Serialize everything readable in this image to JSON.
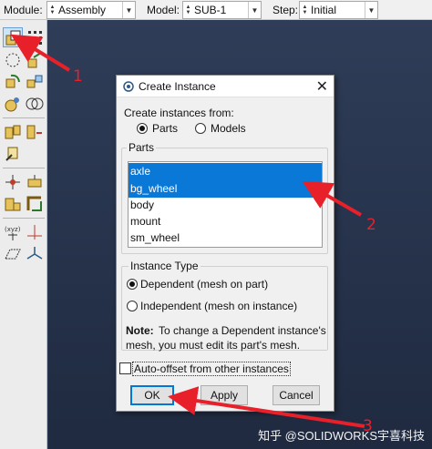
{
  "toolbar": {
    "module_label": "Module:",
    "module_value": "Assembly",
    "model_label": "Model:",
    "model_value": "SUB-1",
    "step_label": "Step:",
    "step_value": "Initial"
  },
  "dialog": {
    "title": "Create Instance",
    "create_from_label": "Create instances from:",
    "source_options": [
      "Parts",
      "Models"
    ],
    "source_selected": "Parts",
    "parts_group_title": "Parts",
    "parts": [
      "axle",
      "bg_wheel",
      "body",
      "mount",
      "sm_wheel"
    ],
    "selected_parts": [
      "axle",
      "bg_wheel"
    ],
    "instance_type_title": "Instance Type",
    "instance_types": [
      "Dependent (mesh on part)",
      "Independent (mesh on instance)"
    ],
    "instance_type_selected": "Dependent (mesh on part)",
    "note_label": "Note:",
    "note_line1": "To change a Dependent instance's",
    "note_line2": "mesh, you must edit its part's mesh.",
    "auto_offset_label": "Auto-offset from other instances",
    "auto_offset_checked": false,
    "ok_label": "OK",
    "apply_label": "Apply",
    "cancel_label": "Cancel"
  },
  "annotations": {
    "marker_1": "1",
    "marker_2": "2",
    "marker_3": "3",
    "color": "#e8202a"
  },
  "watermark": "知乎 @SOLIDWORKS宇喜科技",
  "colors": {
    "selection": "#0a78d7",
    "viewport": "#2b3a55"
  }
}
